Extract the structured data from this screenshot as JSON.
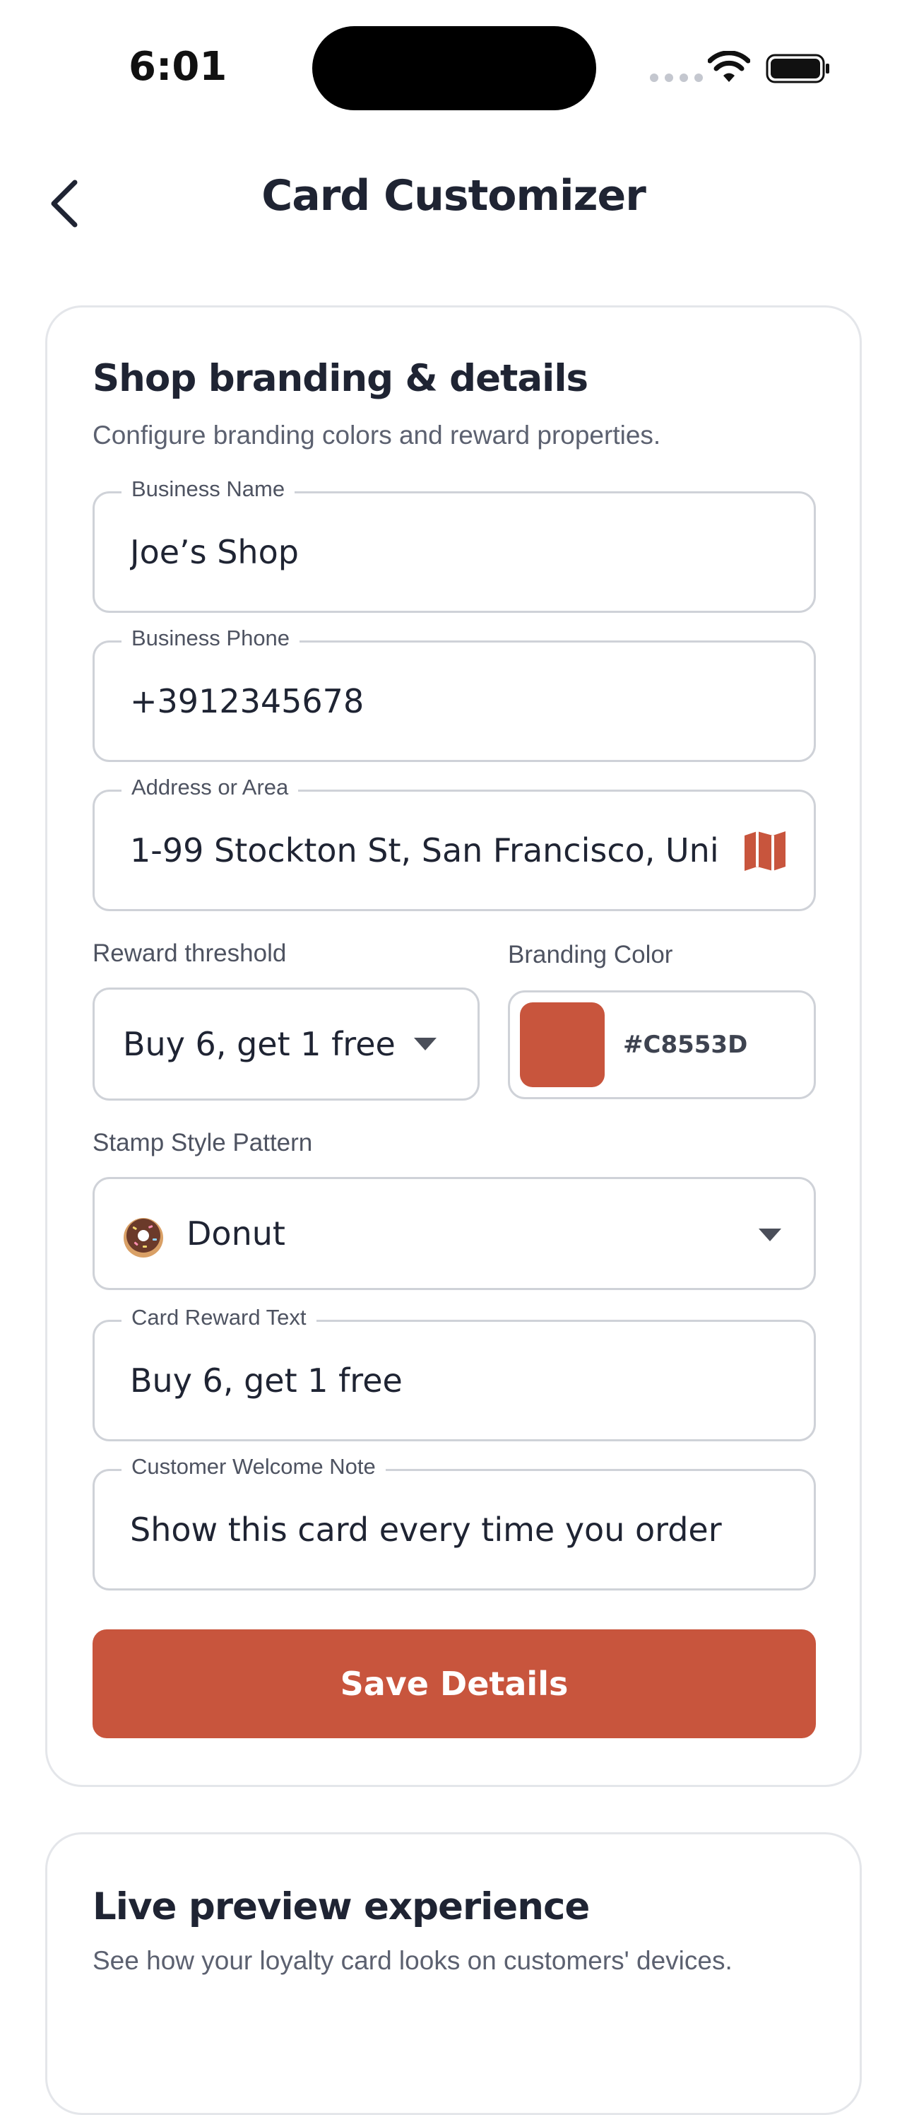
{
  "status_bar": {
    "time": "6:01"
  },
  "header": {
    "title": "Card Customizer"
  },
  "form": {
    "title": "Shop branding & details",
    "subtitle": "Configure branding colors and reward properties.",
    "business_name": {
      "label": "Business Name",
      "value": "Joe’s Shop"
    },
    "business_phone": {
      "label": "Business Phone",
      "value": "+3912345678"
    },
    "address": {
      "label": "Address or Area",
      "value": "1-99 Stockton St, San Francisco, Uni",
      "icon": "map-icon"
    },
    "reward_threshold": {
      "label": "Reward threshold",
      "selected": "Buy 6, get 1 free"
    },
    "branding_color": {
      "label": "Branding Color",
      "hex": "#C8553D",
      "color": "#C8553D"
    },
    "stamp_style": {
      "label": "Stamp Style Pattern",
      "selected": "Donut",
      "icon": "donut-icon"
    },
    "reward_text": {
      "label": "Card Reward Text",
      "value": "Buy 6, get 1 free"
    },
    "welcome_note": {
      "label": "Customer Welcome Note",
      "value": "Show this card every time you order."
    },
    "save_label": "Save Details"
  },
  "preview": {
    "title": "Live preview experience",
    "subtitle": "See how your loyalty card looks on customers' devices."
  },
  "colors": {
    "accent": "#C8553D",
    "text": "#1F2433",
    "muted": "#5C6170",
    "border": "#CFD2D8"
  }
}
